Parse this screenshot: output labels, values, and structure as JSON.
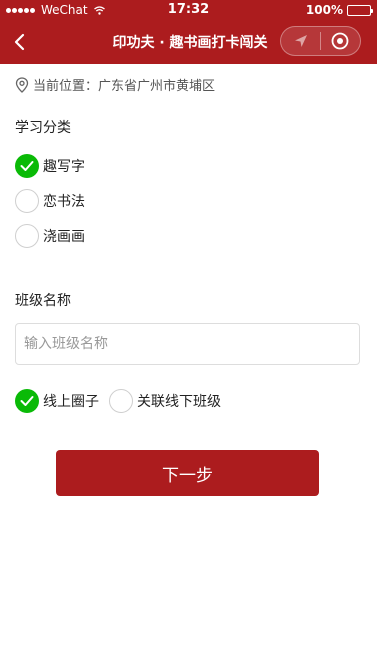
{
  "status_bar": {
    "carrier": "WeChat",
    "time": "17:32",
    "battery_label": "100%"
  },
  "nav": {
    "title": "印功夫 · 趣书画打卡闯关",
    "back_icon": "chevron-left-icon",
    "capsule_icons": [
      "navigation-arrow-icon",
      "target-circle-icon"
    ]
  },
  "location": {
    "label": "当前位置：广东省广州市黄埔区",
    "icon": "map-pin-icon"
  },
  "category": {
    "title": "学习分类",
    "options": [
      {
        "label": "趣写字",
        "checked": true
      },
      {
        "label": "恋书法",
        "checked": false
      },
      {
        "label": "浇画画",
        "checked": false
      }
    ]
  },
  "class_name": {
    "title": "班级名称",
    "value": "",
    "placeholder": "输入班级名称"
  },
  "class_type": {
    "options": [
      {
        "label": "线上圈子",
        "checked": true
      },
      {
        "label": "关联线下班级",
        "checked": false
      }
    ]
  },
  "next_button": {
    "label": "下一步"
  },
  "colors": {
    "brand": "#ac1c1e",
    "check_green": "#0aba07"
  }
}
